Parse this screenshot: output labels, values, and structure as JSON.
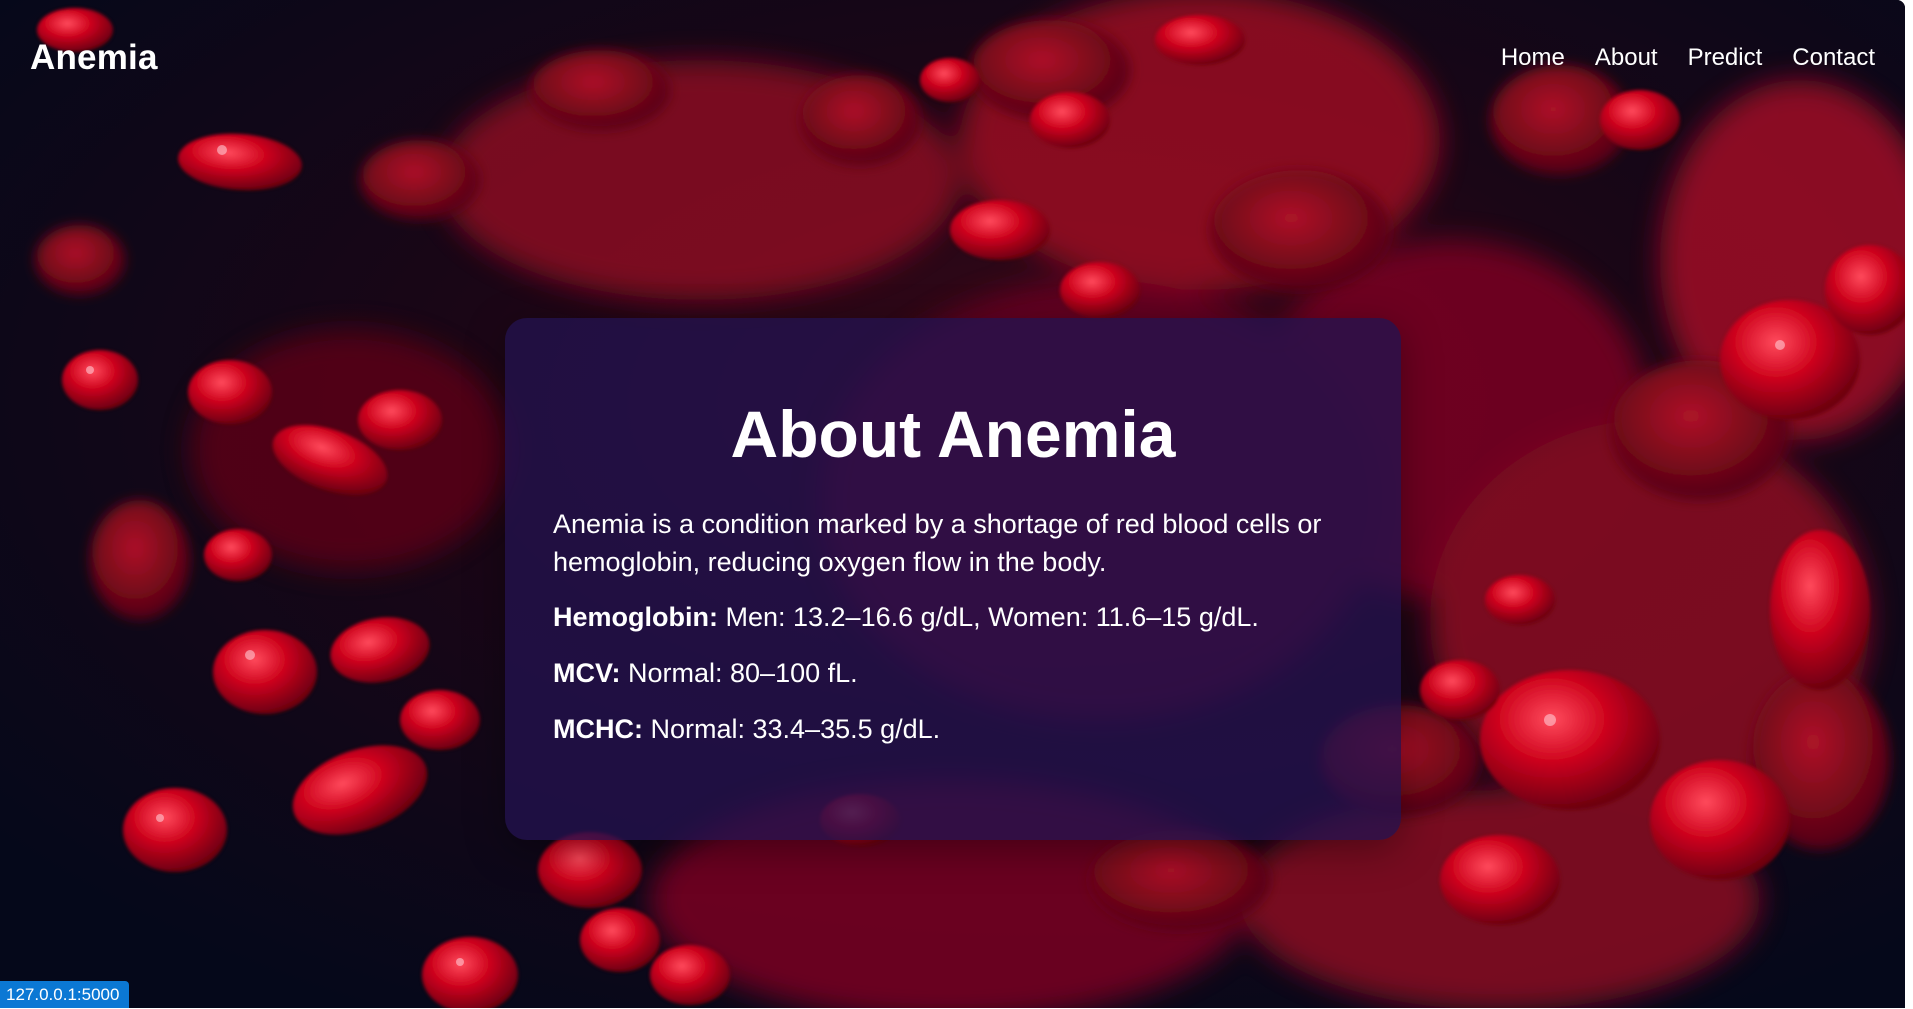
{
  "nav": {
    "brand": "Anemia",
    "links": [
      "Home",
      "About",
      "Predict",
      "Contact"
    ]
  },
  "about": {
    "title": "About Anemia",
    "description": "Anemia is a condition marked by a shortage of red blood cells or hemoglobin, reducing oxygen flow in the body.",
    "stats": [
      {
        "label": "Hemoglobin:",
        "value": " Men: 13.2–16.6 g/dL, Women: 11.6–15 g/dL."
      },
      {
        "label": "MCV:",
        "value": " Normal: 80–100 fL."
      },
      {
        "label": "MCHC:",
        "value": " Normal: 33.4–35.5 g/dL."
      }
    ]
  },
  "status_bar": {
    "url": "127.0.0.1:5000"
  },
  "colors": {
    "card_bg": "#22124e",
    "background_dark": "#070b1e",
    "blood_red": "#c8001c",
    "status_blue": "#0b78d4"
  }
}
